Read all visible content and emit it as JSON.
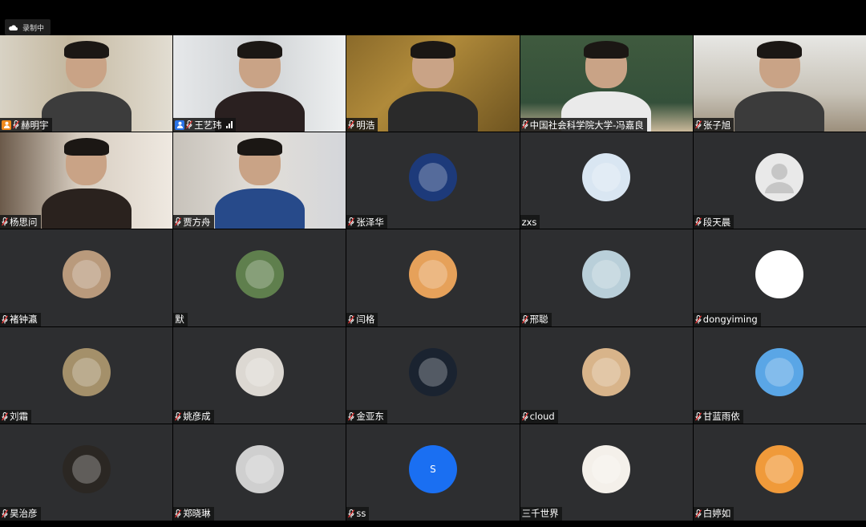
{
  "recording": {
    "label": "录制中"
  },
  "participants": [
    {
      "name": "赫明宇",
      "role": "host",
      "kind": "video",
      "scene": "office"
    },
    {
      "name": "王艺玮",
      "role": "cohost",
      "kind": "video",
      "scene": "room",
      "signal": true
    },
    {
      "name": "明浩",
      "kind": "video",
      "scene": "painting"
    },
    {
      "name": "中国社会科学院大学-冯嘉良",
      "kind": "video",
      "scene": "board"
    },
    {
      "name": "张子旭",
      "kind": "video",
      "scene": "dorm"
    },
    {
      "name": "杨思问",
      "kind": "video",
      "scene": "dorm2"
    },
    {
      "name": "贾方舟",
      "kind": "video",
      "scene": "library"
    },
    {
      "name": "张泽华",
      "kind": "avatar",
      "avatar": "starry-night-avatar",
      "color": "#1d3a7a"
    },
    {
      "name": "zxs",
      "kind": "avatar",
      "mic": false,
      "avatar": "cartoon-bear-avatar",
      "color": "#d9e6f2"
    },
    {
      "name": "段天晨",
      "kind": "avatar",
      "avatar": "default-person-avatar",
      "color": "#e9e9e9"
    },
    {
      "name": "褚钟瀛",
      "kind": "avatar",
      "avatar": "cat-photo-avatar",
      "color": "#b99a7c"
    },
    {
      "name": "默",
      "kind": "avatar",
      "mic": false,
      "avatar": "man-outdoor-avatar",
      "color": "#5f7f4d"
    },
    {
      "name": "闫格",
      "kind": "avatar",
      "avatar": "cartoon-shop-avatar",
      "color": "#e6a15a"
    },
    {
      "name": "邢聪",
      "kind": "avatar",
      "avatar": "lotus-avatar",
      "color": "#b9cfd9"
    },
    {
      "name": "dongyiming",
      "kind": "avatar",
      "avatar": "line-drawing-avatar",
      "color": "#ffffff"
    },
    {
      "name": "刘霜",
      "kind": "avatar",
      "avatar": "woman-photo-avatar",
      "color": "#a4906a"
    },
    {
      "name": "姚彦成",
      "kind": "avatar",
      "avatar": "anime-girl-avatar",
      "color": "#dcd8d2"
    },
    {
      "name": "金亚东",
      "kind": "avatar",
      "avatar": "night-sky-avatar",
      "color": "#1a2330"
    },
    {
      "name": "cloud",
      "kind": "avatar",
      "avatar": "cat-costume-avatar",
      "color": "#d8b48a"
    },
    {
      "name": "甘蓝雨依",
      "kind": "avatar",
      "avatar": "eiffel-tower-avatar",
      "color": "#5aa6e6"
    },
    {
      "name": "昊治彦",
      "kind": "avatar",
      "avatar": "dark-photo-avatar",
      "color": "#2b2723"
    },
    {
      "name": "郑晓琳",
      "kind": "avatar",
      "avatar": "portrait-bw-avatar",
      "color": "#cfcfcf"
    },
    {
      "name": "ss",
      "kind": "avatar",
      "avatar": "letter-avatar",
      "letter": "S",
      "color": "#1a6ff2"
    },
    {
      "name": "三千世界",
      "kind": "avatar",
      "mic": false,
      "avatar": "cute-bun-avatar",
      "color": "#f4f0ea"
    },
    {
      "name": "白婷如",
      "kind": "avatar",
      "avatar": "anime-orange-avatar",
      "color": "#f09a3a"
    }
  ]
}
